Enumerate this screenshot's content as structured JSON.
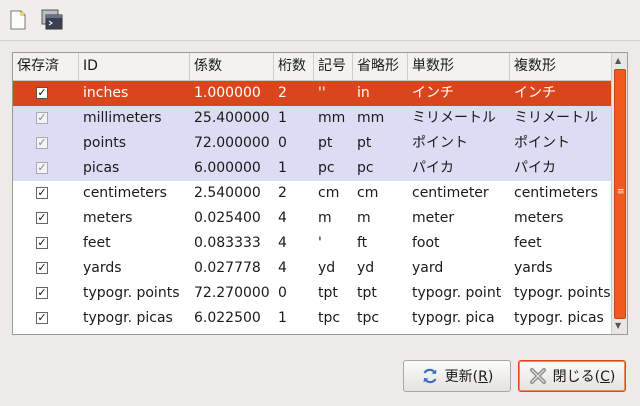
{
  "toolbar": {
    "new_icon": "new-document-icon",
    "terminal_icon": "terminal-window-icon"
  },
  "table": {
    "columns": [
      "保存済",
      "ID",
      "係数",
      "桁数",
      "記号",
      "省略形",
      "単数形",
      "複数形"
    ],
    "rows": [
      {
        "saved": true,
        "state": "selected",
        "id": "inches",
        "factor": "1.000000",
        "digits": "2",
        "symbol": "''",
        "abbr": "in",
        "singular": "インチ",
        "plural": "インチ"
      },
      {
        "saved": true,
        "state": "builtin",
        "id": "millimeters",
        "factor": "25.400000",
        "digits": "1",
        "symbol": "mm",
        "abbr": "mm",
        "singular": "ミリメートル",
        "plural": "ミリメートル"
      },
      {
        "saved": true,
        "state": "builtin",
        "id": "points",
        "factor": "72.000000",
        "digits": "0",
        "symbol": "pt",
        "abbr": "pt",
        "singular": "ポイント",
        "plural": "ポイント"
      },
      {
        "saved": true,
        "state": "builtin",
        "id": "picas",
        "factor": "6.000000",
        "digits": "1",
        "symbol": "pc",
        "abbr": "pc",
        "singular": "パイカ",
        "plural": "パイカ"
      },
      {
        "saved": true,
        "state": "normal",
        "id": "centimeters",
        "factor": "2.540000",
        "digits": "2",
        "symbol": "cm",
        "abbr": "cm",
        "singular": "centimeter",
        "plural": "centimeters"
      },
      {
        "saved": true,
        "state": "normal",
        "id": "meters",
        "factor": "0.025400",
        "digits": "4",
        "symbol": "m",
        "abbr": "m",
        "singular": "meter",
        "plural": "meters"
      },
      {
        "saved": true,
        "state": "normal",
        "id": "feet",
        "factor": "0.083333",
        "digits": "4",
        "symbol": "'",
        "abbr": "ft",
        "singular": "foot",
        "plural": "feet"
      },
      {
        "saved": true,
        "state": "normal",
        "id": "yards",
        "factor": "0.027778",
        "digits": "4",
        "symbol": "yd",
        "abbr": "yd",
        "singular": "yard",
        "plural": "yards"
      },
      {
        "saved": true,
        "state": "normal",
        "id": "typogr. points",
        "factor": "72.270000",
        "digits": "0",
        "symbol": "tpt",
        "abbr": "tpt",
        "singular": "typogr. point",
        "plural": "typogr. points"
      },
      {
        "saved": true,
        "state": "normal",
        "id": "typogr. picas",
        "factor": "6.022500",
        "digits": "1",
        "symbol": "tpc",
        "abbr": "tpc",
        "singular": "typogr. pica",
        "plural": "typogr. picas"
      }
    ]
  },
  "buttons": {
    "refresh_label": "更新(",
    "refresh_mnemonic": "R",
    "refresh_suffix": ")",
    "refresh_icon": "refresh-icon",
    "close_label": "閉じる(",
    "close_mnemonic": "C",
    "close_suffix": ")",
    "close_icon": "close-x-icon"
  },
  "colors": {
    "selected_row": "#d9461e",
    "builtin_row": "#dcdcf4",
    "scrollbar_thumb": "#ef5a1e"
  }
}
